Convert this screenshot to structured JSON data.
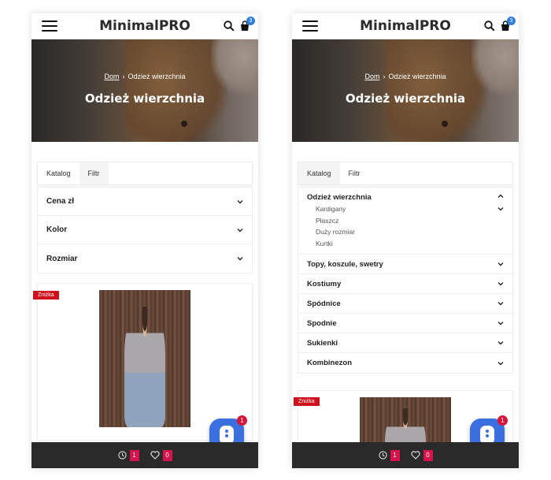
{
  "header": {
    "brand": "MinimalPRO",
    "cart_count": "3"
  },
  "hero": {
    "breadcrumb_home": "Dom",
    "breadcrumb_separator": "›",
    "breadcrumb_current": "Odzież wierzchnia",
    "title": "Odzież wierzchnia"
  },
  "tabs": {
    "catalog": "Katalog",
    "filter": "Filtr"
  },
  "filters": [
    "Cena zł",
    "Kolor",
    "Rozmiar"
  ],
  "categories": {
    "open": {
      "label": "Odzież wierzchnia",
      "sub": [
        "Kardigany",
        "Płaszcz",
        "Duży rozmiar",
        "Kurtki"
      ]
    },
    "rest": [
      "Topy, koszule, swetry",
      "Kostiumy",
      "Spódnice",
      "Spodnie",
      "Sukienki",
      "Kombinezon"
    ]
  },
  "product": {
    "badge": "Zniżka"
  },
  "bottom_bar": {
    "recent_count": "1",
    "wishlist_count": "0"
  },
  "chat": {
    "badge": "1"
  },
  "colors": {
    "accent_blue": "#3b6fe0",
    "badge_red": "#d0101d",
    "count_pink": "#d8124a",
    "bar_dark": "#2a2a2a"
  }
}
